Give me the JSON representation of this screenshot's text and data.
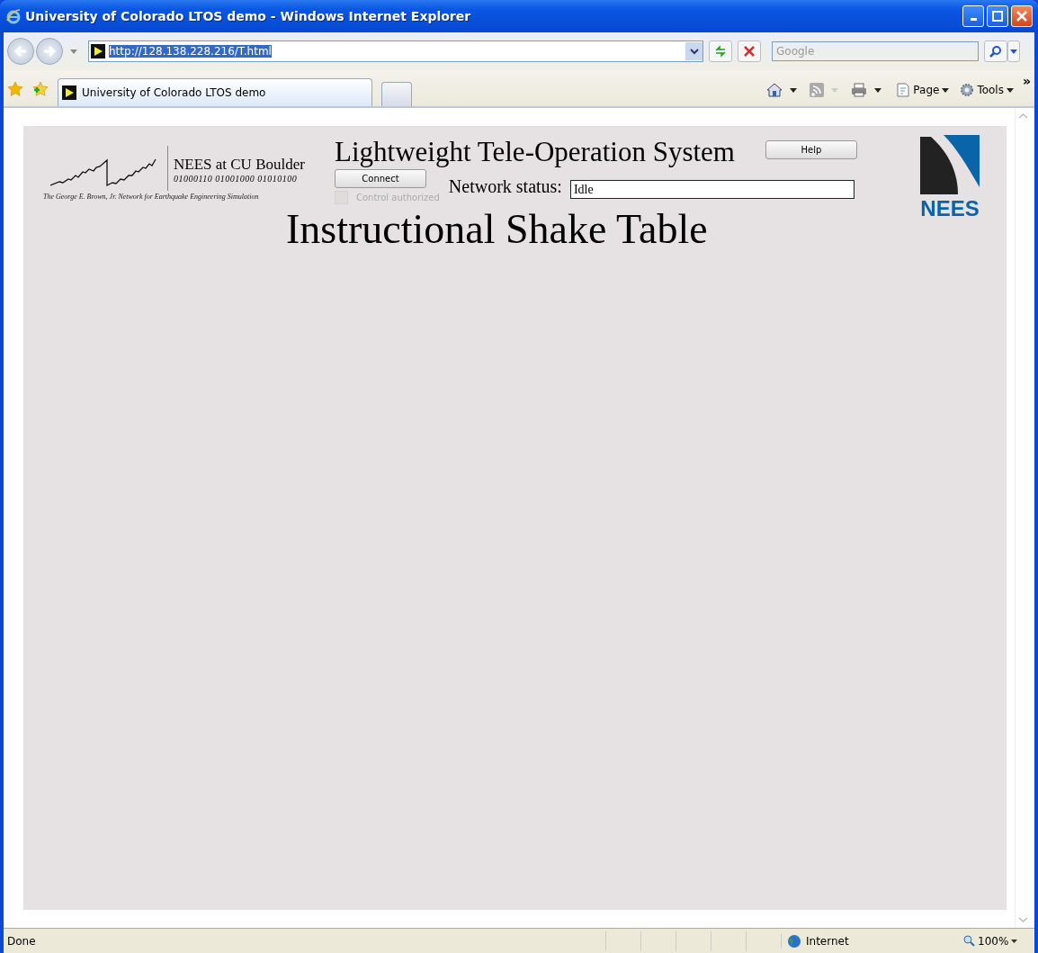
{
  "window": {
    "title": "University of Colorado LTOS demo - Windows Internet Explorer"
  },
  "address": {
    "url": "http://128.138.228.216/T.html"
  },
  "search": {
    "placeholder": "Google"
  },
  "tabs": [
    {
      "label": "University of Colorado LTOS demo",
      "selected": true
    },
    {
      "selected": false
    }
  ],
  "command_bar": {
    "items": [
      {
        "label": "Page"
      },
      {
        "label": "Tools"
      }
    ],
    "overflow": "»"
  },
  "panel": {
    "logo": {
      "name": "NEES at CU Boulder",
      "binary": "01000110 01001000 01010100",
      "caption": "The George E. Brown, Jr. Network for Earthquake Engineering Simulation"
    },
    "title": "Lightweight Tele-Operation System",
    "connect_button": "Connect",
    "help_button": "Help",
    "network_status": {
      "label": "Network status:",
      "value": "Idle"
    },
    "control_authorized": {
      "label": "Control authorized",
      "checked": false,
      "disabled": true
    },
    "nees_logo": "NEES",
    "heading": "Instructional Shake Table"
  },
  "status_bar": {
    "text": "Done",
    "zone": "Internet",
    "zoom": "100%"
  }
}
